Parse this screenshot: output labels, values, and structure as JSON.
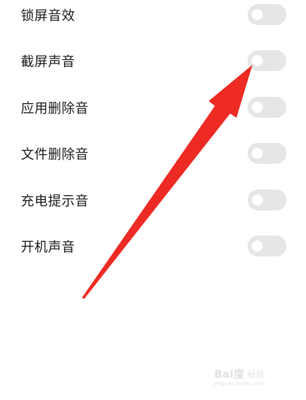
{
  "settings": {
    "items": [
      {
        "label": "锁屏音效",
        "enabled": false
      },
      {
        "label": "截屏声音",
        "enabled": false
      },
      {
        "label": "应用删除音",
        "enabled": false
      },
      {
        "label": "文件删除音",
        "enabled": false
      },
      {
        "label": "充电提示音",
        "enabled": false
      },
      {
        "label": "开机声音",
        "enabled": false
      }
    ]
  },
  "annotation": {
    "type": "arrow",
    "color": "#ee2a24",
    "points_to": "截屏声音"
  },
  "watermark": {
    "logo": "Bai度",
    "brand": "经验",
    "url": "jingyan.baidu.com"
  }
}
